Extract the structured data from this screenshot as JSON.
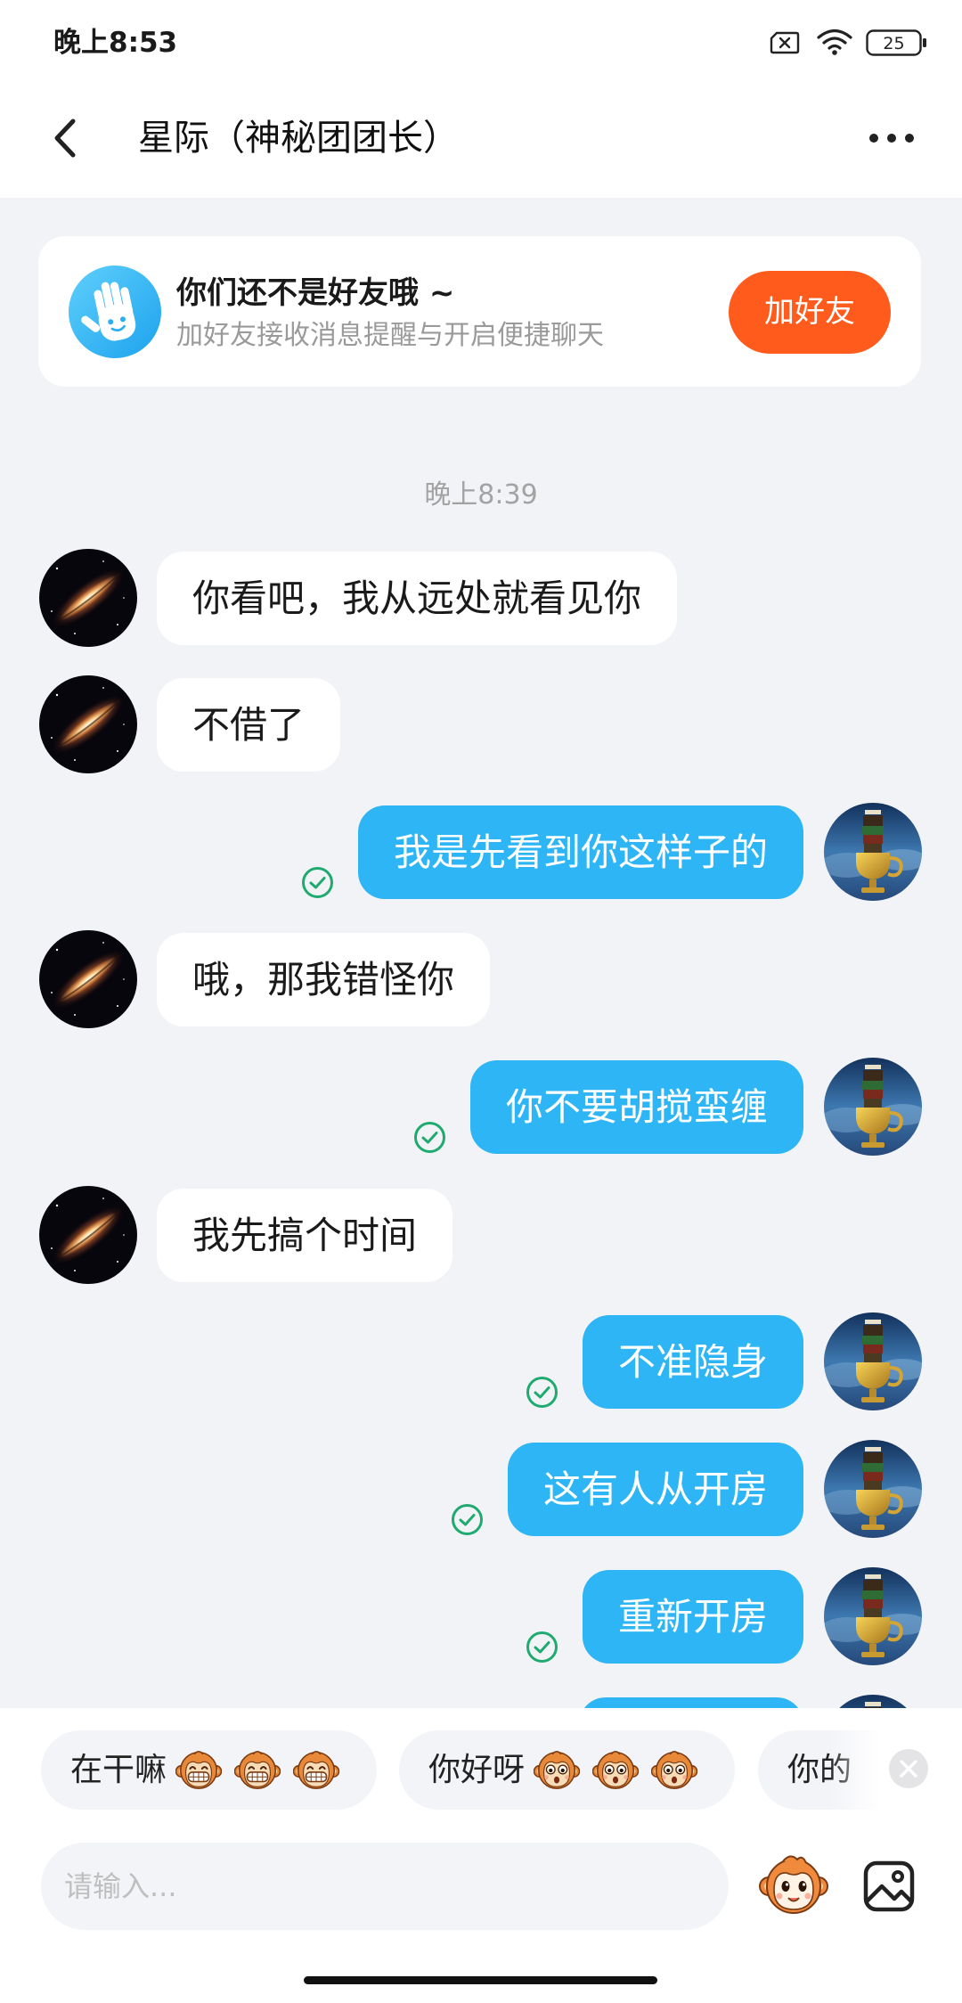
{
  "status_bar": {
    "time": "晚上8:53",
    "battery_level": "25",
    "icons": [
      "sim-no-service-icon",
      "wifi-icon",
      "battery-icon"
    ]
  },
  "header": {
    "back_icon": "chevron-left-icon",
    "title": "星际（神秘团团长）",
    "more_icon": "more-horizontal-icon"
  },
  "friend_banner": {
    "icon": "waving-hand-icon",
    "title": "你们还不是好友哦 ~",
    "subtitle": "加好友接收消息提醒与开启便捷聊天",
    "button_label": "加好友"
  },
  "chat": {
    "timestamp": "晚上8:39",
    "status_icon": "check-circle-icon",
    "messages": [
      {
        "outgoing": false,
        "text": "你看吧，我从远处就看见你"
      },
      {
        "outgoing": false,
        "text": "不借了"
      },
      {
        "outgoing": true,
        "text": "我是先看到你这样子的"
      },
      {
        "outgoing": false,
        "text": "哦，那我错怪你"
      },
      {
        "outgoing": true,
        "text": "你不要胡搅蛮缠"
      },
      {
        "outgoing": false,
        "text": "我先搞个时间"
      },
      {
        "outgoing": true,
        "text": "不准隐身"
      },
      {
        "outgoing": true,
        "text": "这有人从开房"
      },
      {
        "outgoing": true,
        "text": "重新开房"
      }
    ]
  },
  "quick_replies": {
    "items": [
      {
        "text": "在干嘛",
        "emoji": "grinning-monkey-icon",
        "emoji_count": 3
      },
      {
        "text": "你好呀",
        "emoji": "surprised-monkey-icon",
        "emoji_count": 3
      },
      {
        "text": "你的"
      }
    ],
    "close_icon": "close-circle-icon"
  },
  "composer": {
    "placeholder": "请输入...",
    "sticker_icon": "monkey-sticker-icon",
    "image_icon": "image-icon"
  },
  "colors": {
    "page_background": "#f2f3f7",
    "outgoing_bubble": "#2db5f5",
    "add_friend_button": "#ff5b1c",
    "check_icon": "#1fab6f",
    "timestamp_text": "#a3a3a3"
  }
}
